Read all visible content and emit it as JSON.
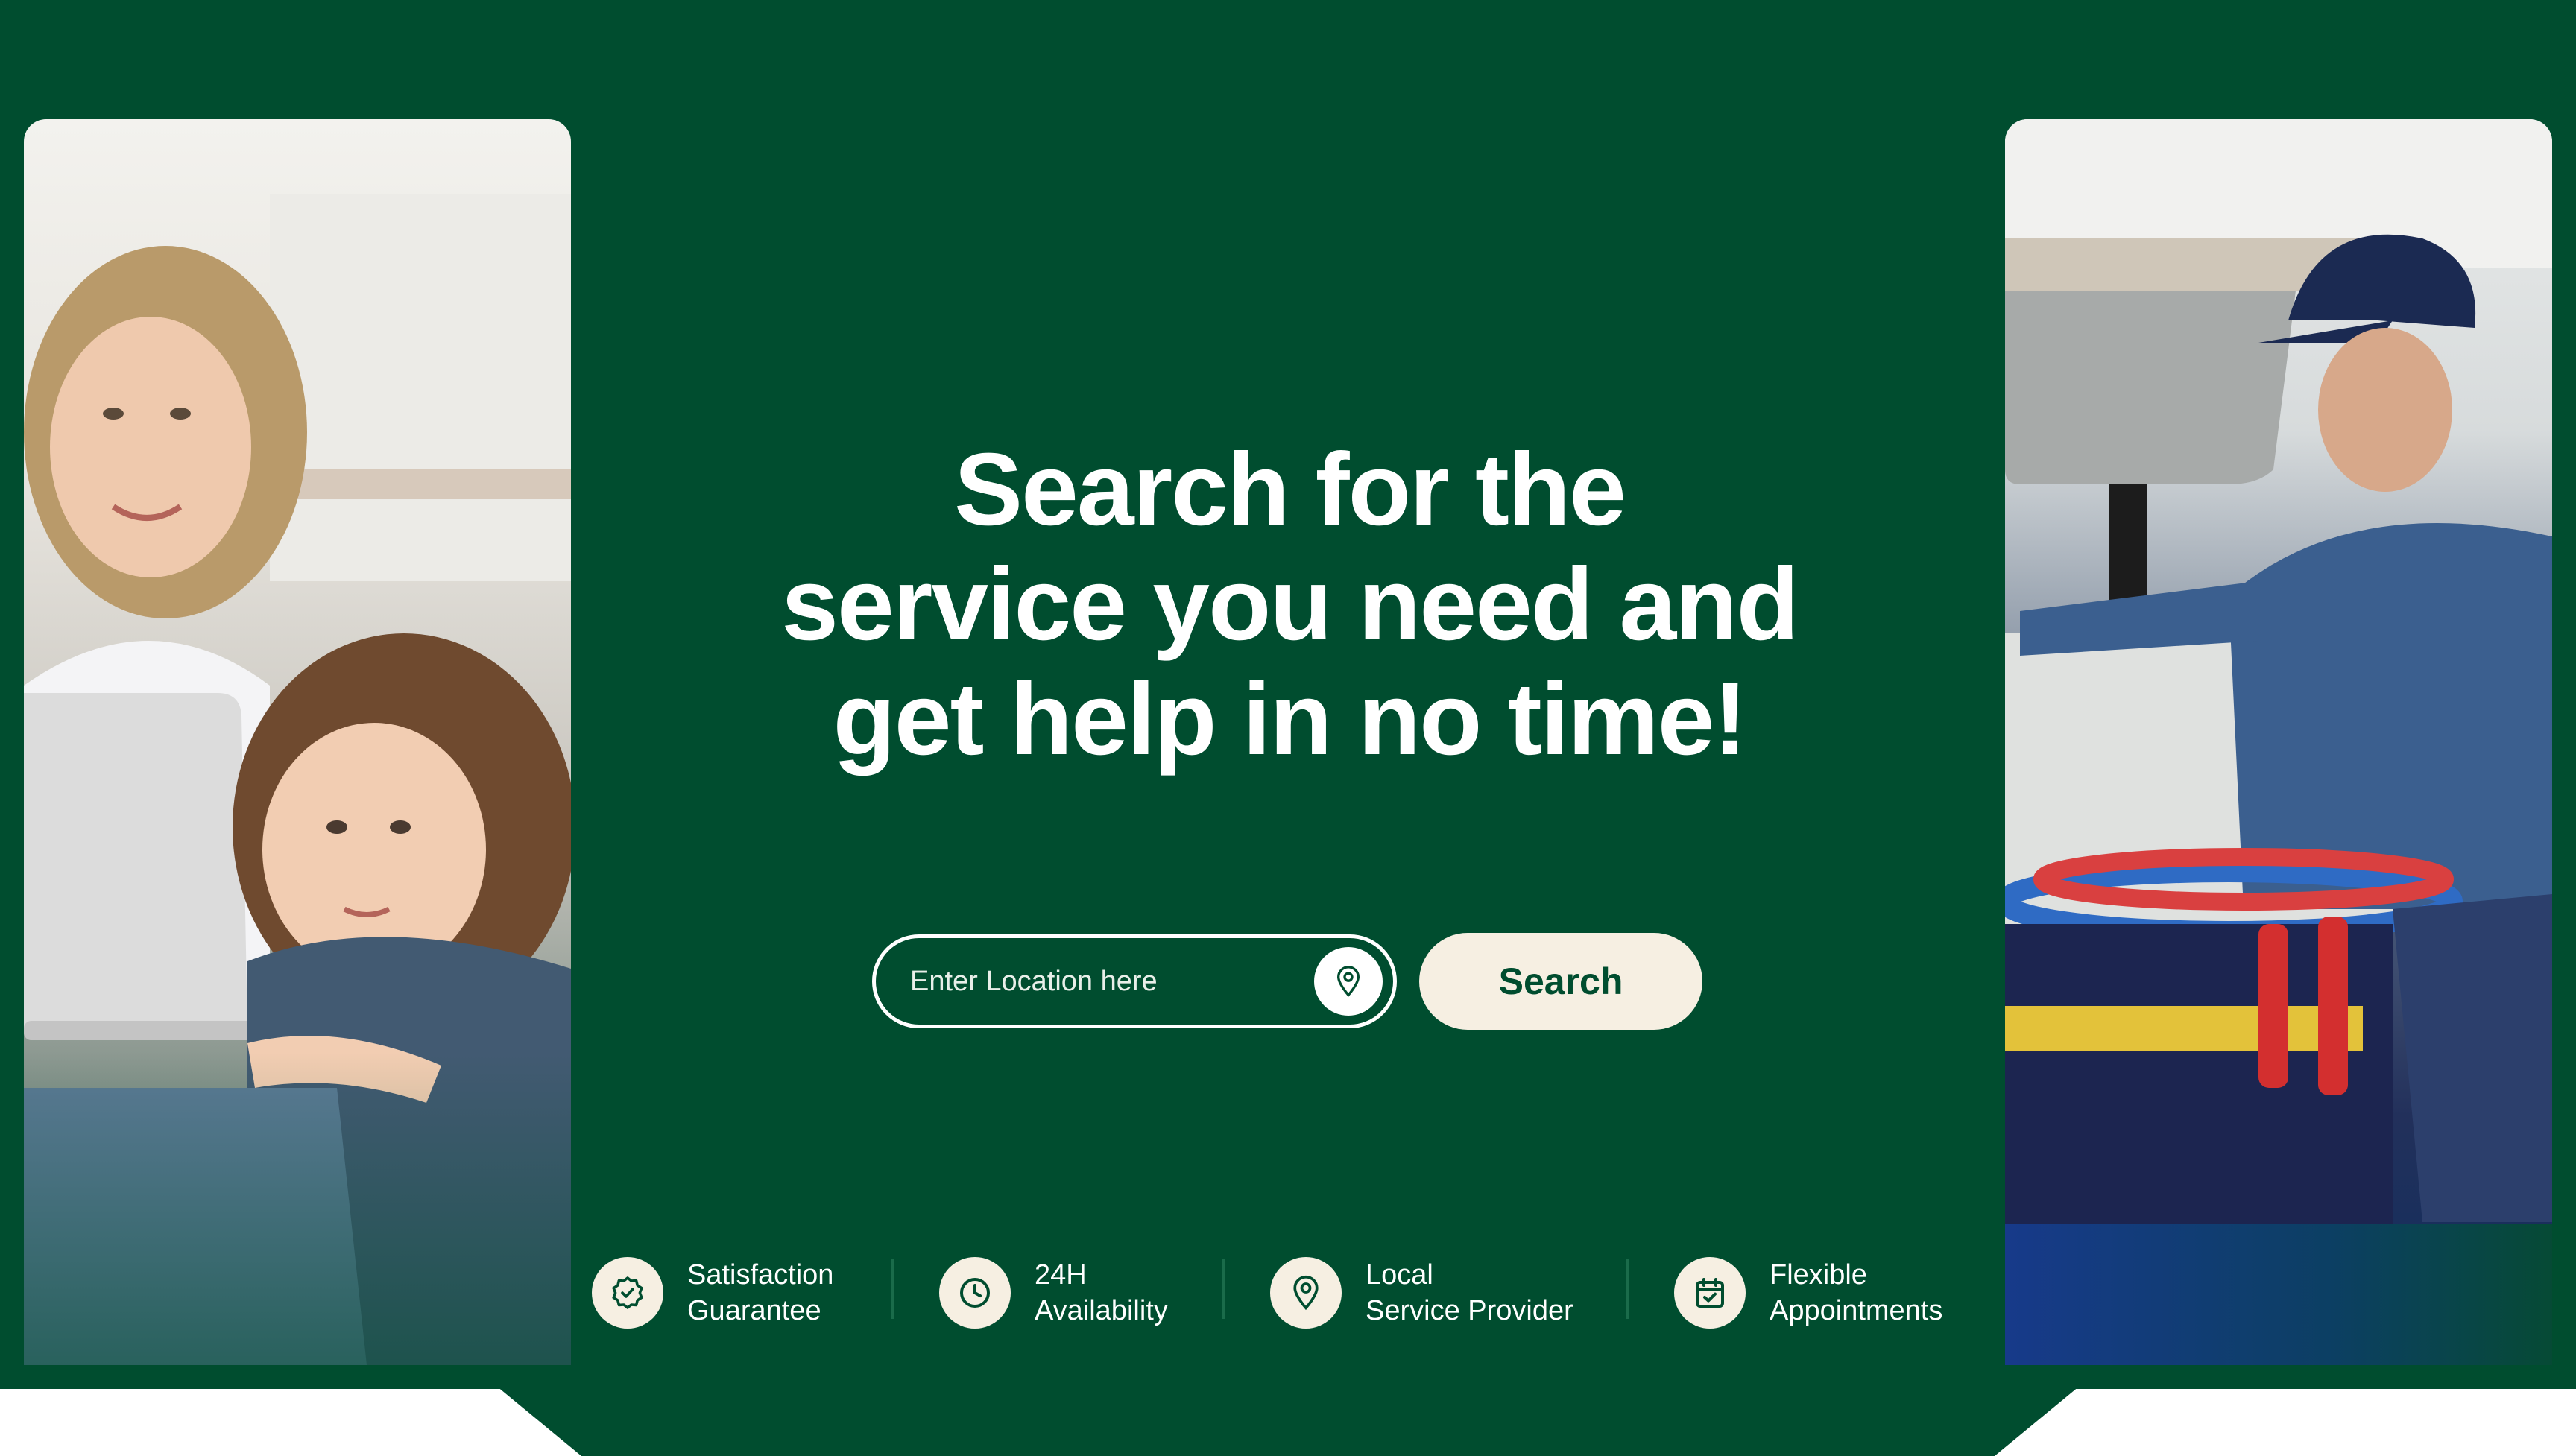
{
  "hero": {
    "title_line1": "Search for the",
    "title_line2": "service you need and",
    "title_line3": "get help in no time!"
  },
  "search": {
    "location_placeholder": "Enter Location here",
    "location_icon": "map-pin-icon",
    "search_label": "Search"
  },
  "features": [
    {
      "icon": "verified-badge-icon",
      "line1": "Satisfaction",
      "line2": "Guarantee"
    },
    {
      "icon": "clock-icon",
      "line1": "24H",
      "line2": "Availability"
    },
    {
      "icon": "map-pin-icon",
      "line1": "Local",
      "line2": "Service Provider"
    },
    {
      "icon": "calendar-check-icon",
      "line1": "Flexible",
      "line2": "Appointments"
    }
  ],
  "images": {
    "left_photo": "mother-and-daughter-using-laptop-photo",
    "right_photo": "plumber-repairing-sink-photo"
  },
  "colors": {
    "background": "#004d2f",
    "accent_cream": "#f6efe2",
    "text_light": "#ffffff",
    "text_dark": "#004d2f"
  }
}
